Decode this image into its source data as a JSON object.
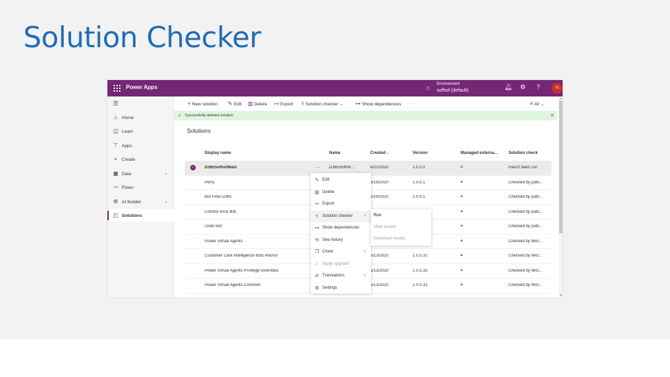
{
  "slide": {
    "title": "Solution Checker"
  },
  "app": {
    "name": "Power Apps",
    "environment_label": "Environment",
    "environment_value": "sofhof (default)",
    "avatar_initials": "YI",
    "colors": {
      "brand": "#742774",
      "success_bg": "#dff6dd",
      "avatar": "#c43131",
      "title": "#1f6db5"
    }
  },
  "sidebar": {
    "items": [
      {
        "label": "Home",
        "icon": "home-icon",
        "glyph": "⌂"
      },
      {
        "label": "Learn",
        "icon": "book-icon",
        "glyph": "◫"
      },
      {
        "label": "Apps",
        "icon": "apps-icon",
        "glyph": "⊤"
      },
      {
        "label": "Create",
        "icon": "plus-icon",
        "glyph": "+"
      },
      {
        "label": "Data",
        "icon": "database-icon",
        "glyph": "▦",
        "chevron": "⌄"
      },
      {
        "label": "Flows",
        "icon": "flow-icon",
        "glyph": "⤳"
      },
      {
        "label": "AI Builder",
        "icon": "ai-icon",
        "glyph": "⚙",
        "chevron": "⌄"
      },
      {
        "label": "Solutions",
        "icon": "solutions-icon",
        "glyph": "◰",
        "active": true
      }
    ]
  },
  "commands": {
    "new_solution": "New solution",
    "edit": "Edit",
    "delete": "Delete",
    "export": "Export",
    "solution_checker": "Solution checker",
    "show_dependencies": "Show dependences",
    "more": "···",
    "filter": "All"
  },
  "banner": {
    "text": "Successfully deleted solution"
  },
  "main": {
    "title": "Solutions"
  },
  "table": {
    "columns": [
      "Display name",
      "Name",
      "Created ↓",
      "Version",
      "Managed externa...",
      "Solution check"
    ],
    "rows": [
      {
        "display": "D365SofhofMain",
        "name": "D365Sofhof...",
        "created": "6/22/2020",
        "version": "1.0.0.0",
        "check": "Hasn't been run",
        "selected": true
      },
      {
        "display": "Perry",
        "name": "",
        "created": "6/19/2020",
        "version": "1.0.0.1",
        "check": "Checked by publ..."
      },
      {
        "display": "Bot Flow D365",
        "name": "",
        "created": "6/19/2020",
        "version": "1.0.0.1",
        "check": "Checked by publ..."
      },
      {
        "display": "Corona Virus Bot",
        "name": "",
        "created": "",
        "version": "",
        "check": "Checked by publ..."
      },
      {
        "display": "Undo Bot",
        "name": "",
        "created": "",
        "version": "",
        "check": "Checked by publ..."
      },
      {
        "display": "Power Virtual Agents",
        "name": "",
        "created": "",
        "version": "",
        "check": "Checked by Micr..."
      },
      {
        "display": "Customer Care Intelligence Bots Anchor",
        "name": "",
        "created": "5/13/2020",
        "version": "1.0.0.32",
        "check": "Checked by Micr..."
      },
      {
        "display": "Power Virtual Agents Privilege Overrides",
        "name": "",
        "created": "5/13/2020",
        "version": "1.0.0.32",
        "check": "Checked by Micr..."
      },
      {
        "display": "Power Virtual Agents Common",
        "name": "",
        "created": "5/13/2020",
        "version": "1.0.0.31",
        "check": "Checked by Micr..."
      }
    ]
  },
  "context_menu": {
    "items": [
      {
        "label": "Edit",
        "icon": "edit-icon",
        "glyph": "✎"
      },
      {
        "label": "Delete",
        "icon": "trash-icon",
        "glyph": "🗑"
      },
      {
        "label": "Export",
        "icon": "export-icon",
        "glyph": "↦"
      },
      {
        "label": "Solution checker",
        "icon": "checker-icon",
        "glyph": "⚕",
        "submenu": true,
        "highlighted": true
      },
      {
        "label": "Show dependencies",
        "icon": "dependencies-icon",
        "glyph": "⊶"
      },
      {
        "label": "See history",
        "icon": "history-icon",
        "glyph": "⟲"
      },
      {
        "label": "Clone",
        "icon": "clone-icon",
        "glyph": "❐",
        "submenu": true
      },
      {
        "label": "Apply upgrade",
        "icon": "check-icon",
        "glyph": "✓",
        "disabled": true
      },
      {
        "label": "Translations",
        "icon": "translate-icon",
        "glyph": "⇄",
        "submenu": true
      },
      {
        "label": "Settings",
        "icon": "settings-icon",
        "glyph": "⚙"
      }
    ]
  },
  "submenu": {
    "run": "Run",
    "view_results": "View results",
    "download_results": "Download results"
  }
}
